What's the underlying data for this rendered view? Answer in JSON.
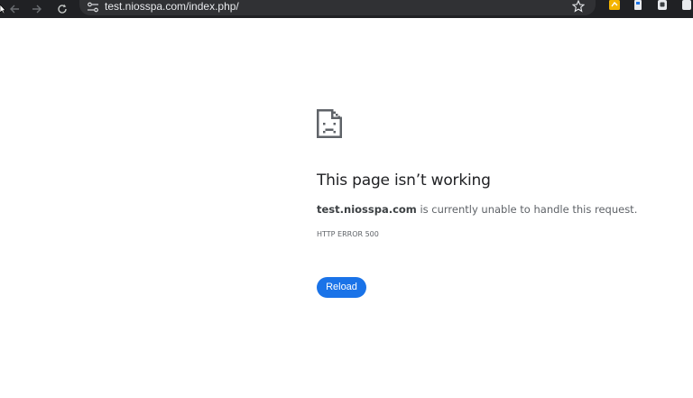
{
  "browser": {
    "url": "test.niosspa.com/index.php/",
    "back_icon": "back-arrow-icon",
    "forward_icon": "forward-arrow-icon",
    "reload_icon": "reload-icon",
    "site_info_icon": "site-info-icon",
    "bookmark_icon": "star-icon",
    "toolbar_color": "#202124",
    "omnibox_color": "#303134"
  },
  "error": {
    "icon": "sad-page-icon",
    "title": "This page isn’t working",
    "host": "test.niosspa.com",
    "message": " is currently unable to handle this request.",
    "code": "HTTP ERROR 500",
    "reload_label": "Reload",
    "button_color": "#1a73e8"
  }
}
